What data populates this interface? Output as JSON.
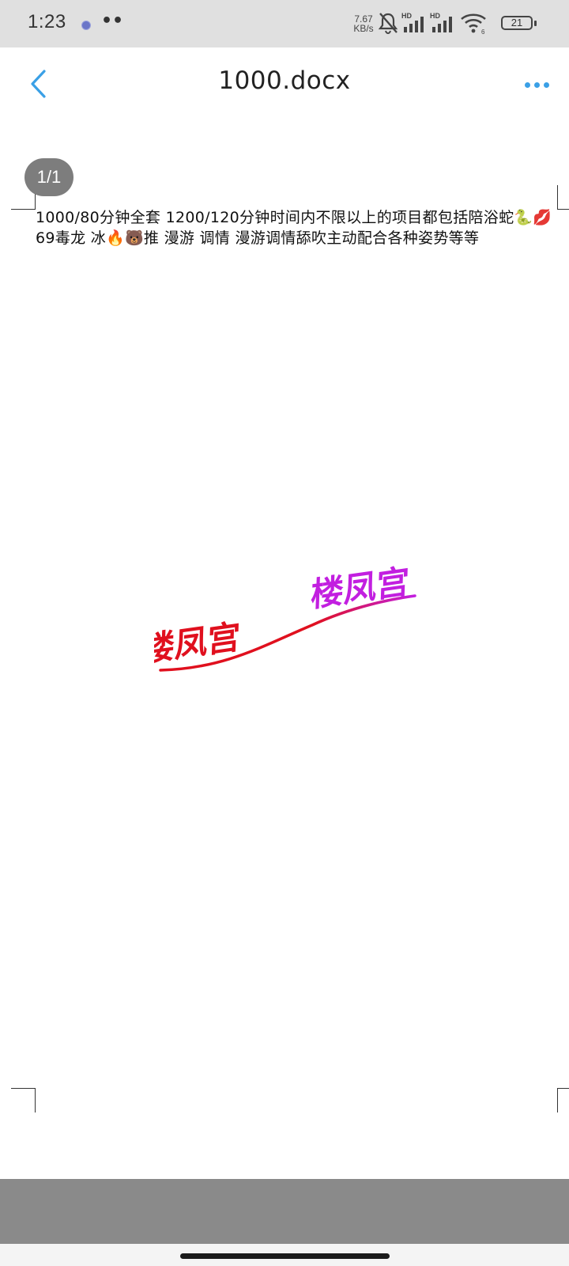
{
  "status_bar": {
    "time": "1:23",
    "notification_dots": "••",
    "net_speed_value": "7.67",
    "net_speed_unit": "KB/s",
    "battery": "21",
    "icons": [
      "mute-bell-icon",
      "hd-signal-icon",
      "hd-signal-icon",
      "wifi-icon",
      "battery-icon"
    ]
  },
  "header": {
    "title": "1000.docx",
    "back_icon": "chevron-left-icon",
    "more_icon": "more-dots-icon",
    "accent_color": "#3aa0e6"
  },
  "page_counter": "1/1",
  "document": {
    "paragraph": "1000/80分钟全套   1200/120分钟时间内不限以上的项目都包括陪浴蛇🐍💋69毒龙 冰🔥🐻推 漫游   调情 漫游调情舔吹主动配合各种姿势等等"
  },
  "logo": {
    "text_left": "楼凤宫",
    "text_right": "楼凤宫",
    "color_left": "#e0101e",
    "color_right": "#c21fe0"
  }
}
